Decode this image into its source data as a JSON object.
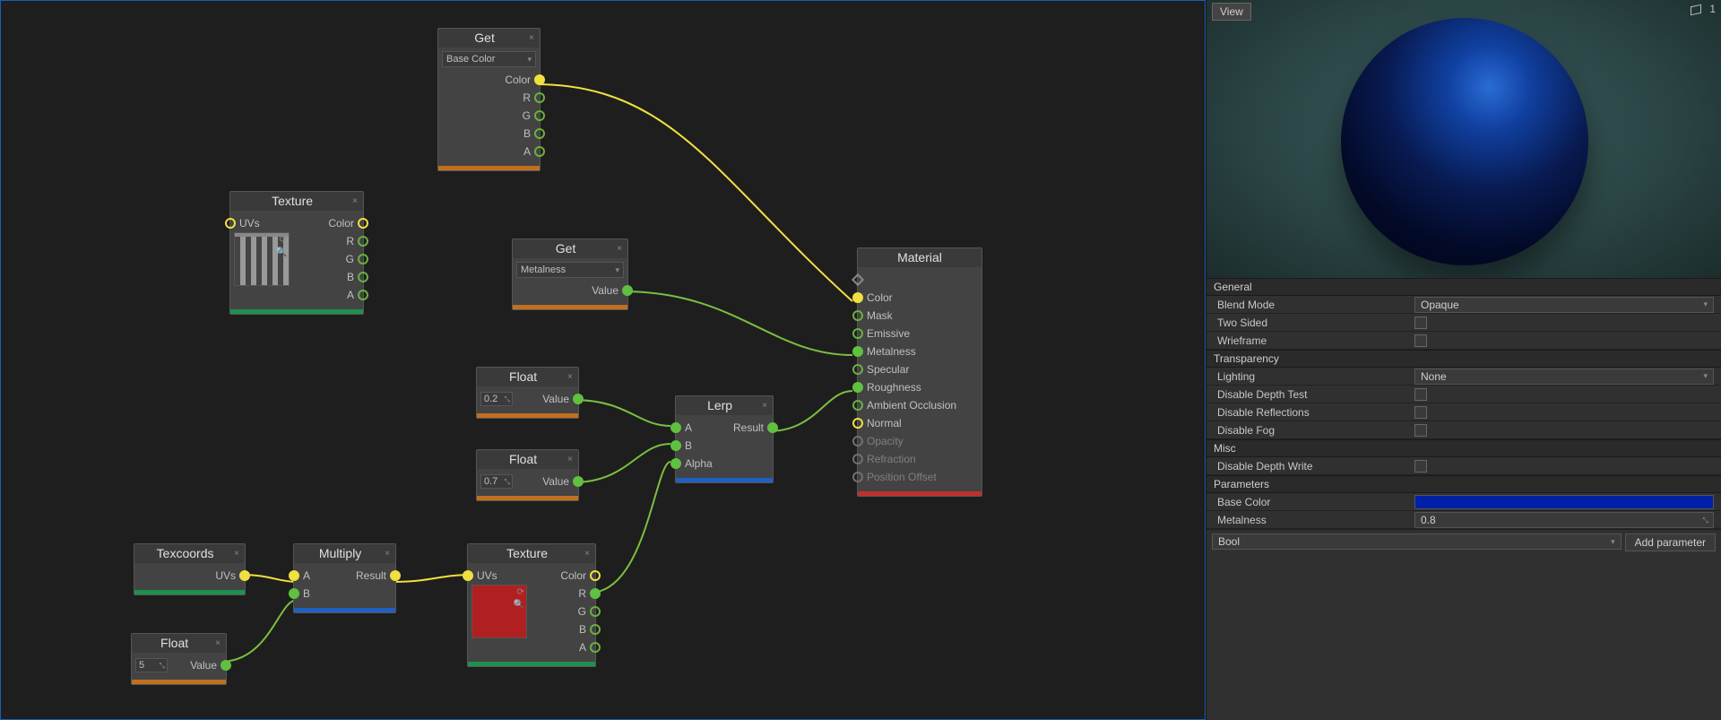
{
  "nodes": {
    "texture1": {
      "title": "Texture",
      "in_uvs": "UVs",
      "out_color": "Color",
      "out_r": "R",
      "out_g": "G",
      "out_b": "B",
      "out_a": "A"
    },
    "get_color": {
      "title": "Get",
      "select": "Base Color",
      "out_color": "Color",
      "out_r": "R",
      "out_g": "G",
      "out_b": "B",
      "out_a": "A"
    },
    "get_metal": {
      "title": "Get",
      "select": "Metalness",
      "out_value": "Value"
    },
    "float1": {
      "title": "Float",
      "value": "0.2",
      "out": "Value"
    },
    "float2": {
      "title": "Float",
      "value": "0.7",
      "out": "Value"
    },
    "float3": {
      "title": "Float",
      "value": "5",
      "out": "Value"
    },
    "texcoords": {
      "title": "Texcoords",
      "out": "UVs"
    },
    "multiply": {
      "title": "Multiply",
      "in_a": "A",
      "in_b": "B",
      "out": "Result"
    },
    "texture2": {
      "title": "Texture",
      "in_uvs": "UVs",
      "out_color": "Color",
      "out_r": "R",
      "out_g": "G",
      "out_b": "B",
      "out_a": "A"
    },
    "lerp": {
      "title": "Lerp",
      "in_a": "A",
      "in_b": "B",
      "in_alpha": "Alpha",
      "out": "Result"
    },
    "material": {
      "title": "Material",
      "ports": {
        "color": "Color",
        "mask": "Mask",
        "emissive": "Emissive",
        "metalness": "Metalness",
        "specular": "Specular",
        "roughness": "Roughness",
        "ao": "Ambient Occlusion",
        "normal": "Normal",
        "opacity": "Opacity",
        "refraction": "Refraction",
        "posoff": "Position Offset"
      }
    }
  },
  "inspector": {
    "view_btn": "View",
    "count": "1",
    "sections": {
      "general": "General",
      "transparency": "Transparency",
      "misc": "Misc",
      "parameters": "Parameters"
    },
    "props": {
      "blend_mode": {
        "label": "Blend  Mode",
        "value": "Opaque"
      },
      "two_sided": {
        "label": "Two  Sided"
      },
      "wireframe": {
        "label": "Wrieframe"
      },
      "lighting": {
        "label": "Lighting",
        "value": "None"
      },
      "depth_test": {
        "label": "Disable  Depth  Test"
      },
      "reflections": {
        "label": "Disable  Reflections"
      },
      "fog": {
        "label": "Disable  Fog"
      },
      "depth_write": {
        "label": "Disable  Depth  Write"
      },
      "base_color": {
        "label": "Base  Color"
      },
      "metalness": {
        "label": "Metalness",
        "value": "0.8"
      }
    },
    "add_param": {
      "select": "Bool",
      "button": "Add parameter"
    }
  }
}
